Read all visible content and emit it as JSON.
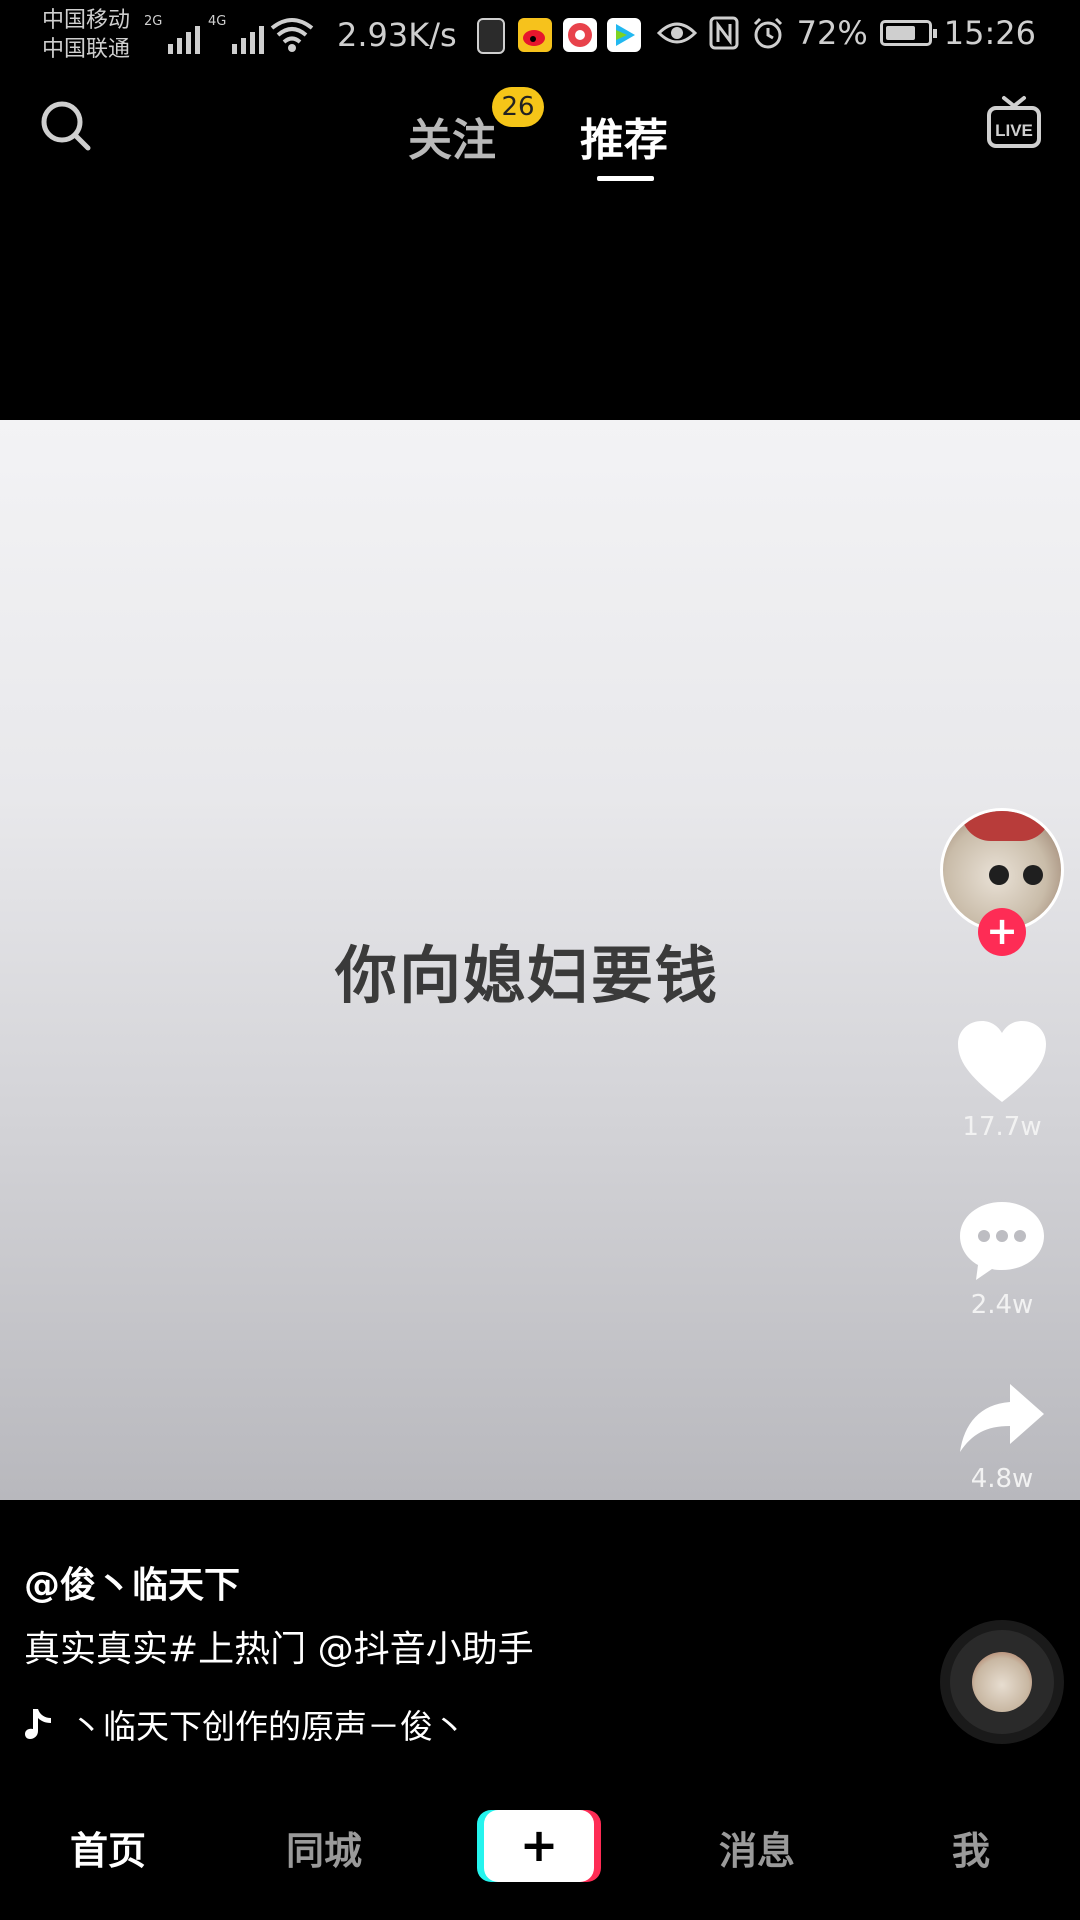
{
  "status_bar": {
    "carrier_1": "中国移动",
    "carrier_2": "中国联通",
    "signal_1_tag": "2G",
    "signal_2_tag": "4G",
    "net_speed": "2.93K/s",
    "battery_percent": "72%",
    "time": "15:26",
    "app_icons": [
      "upload-icon",
      "weibo-icon",
      "app-icon",
      "video-app-icon"
    ],
    "right_icons": [
      "eye-icon",
      "nfc-icon",
      "alarm-icon",
      "battery-icon"
    ],
    "battery_level": 0.72
  },
  "top_nav": {
    "follow_label": "关注",
    "follow_badge": "26",
    "recommend_label": "推荐",
    "active_tab": "推荐"
  },
  "video": {
    "caption": "你向媳妇要钱"
  },
  "actions": {
    "like_count": "17.7w",
    "comment_count": "2.4w",
    "share_count": "4.8w"
  },
  "post": {
    "author": "@俊丶临天下",
    "description": "真实真实#上热门 @抖音小助手",
    "music": "丶临天下创作的原声－俊丶"
  },
  "bottom_nav": {
    "home": "首页",
    "city": "同城",
    "create": "+",
    "messages": "消息",
    "me": "我",
    "active": "首页"
  },
  "colors": {
    "accent_red": "#fe2c55",
    "accent_cyan": "#25f4ee",
    "badge_yellow": "#f5c518"
  }
}
